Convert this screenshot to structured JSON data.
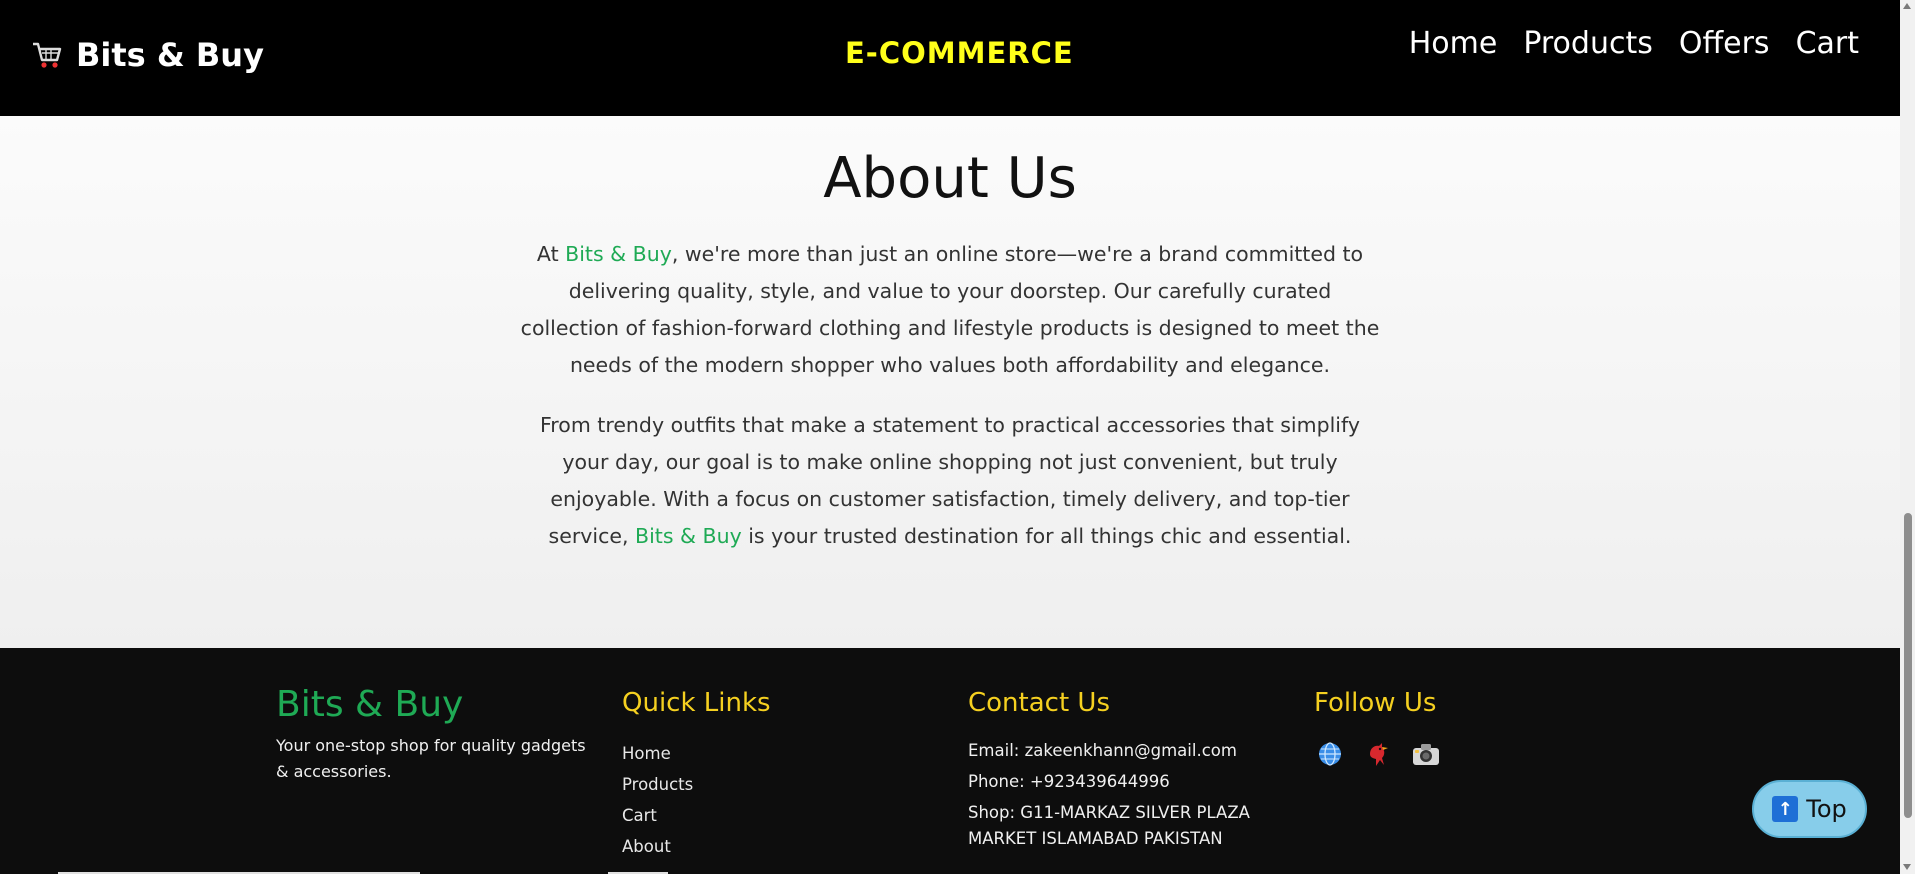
{
  "header": {
    "brand_name": "Bits & Buy",
    "logo_icon": "shopping-cart-icon",
    "center_title": "E-COMMERCE",
    "nav": [
      "Home",
      "Products",
      "Offers",
      "Cart"
    ]
  },
  "about": {
    "title": "About Us",
    "p1_before": "At ",
    "brand": "Bits & Buy",
    "p1_after": ", we're more than just an online store—we're a brand committed to delivering quality, style, and value to your doorstep. Our carefully curated collection of fashion-forward clothing and lifestyle products is designed to meet the needs of the modern shopper who values both affordability and elegance.",
    "p2_before": "From trendy outfits that make a statement to practical accessories that simplify your day, our goal is to make online shopping not just convenient, but truly enjoyable. With a focus on customer satisfaction, timely delivery, and top-tier service, ",
    "p2_after": " is your trusted destination for all things chic and essential."
  },
  "footer": {
    "brand_name": "Bits & Buy",
    "tagline": "Your one-stop shop for quality gadgets & accessories.",
    "quick_links_title": "Quick Links",
    "quick_links": [
      "Home",
      "Products",
      "Cart",
      "About"
    ],
    "contact_title": "Contact Us",
    "email": "Email: zakeenkhann@gmail.com",
    "phone": "Phone: +923439644996",
    "shop": "Shop: G11-MARKAZ SILVER PLAZA MARKET ISLAMABAD PAKISTAN",
    "follow_title": "Follow Us",
    "social_icons": [
      "globe-icon",
      "bird-icon",
      "camera-icon"
    ]
  },
  "top_button": {
    "label": "Top",
    "icon": "up-arrow-icon"
  },
  "colors": {
    "header_bg": "#000000",
    "title_yellow": "#ffff1a",
    "brand_green": "#1faa55",
    "footer_heading": "#f5d020",
    "footer_bg": "#0d0d0d",
    "top_button_bg": "#87cdea"
  }
}
